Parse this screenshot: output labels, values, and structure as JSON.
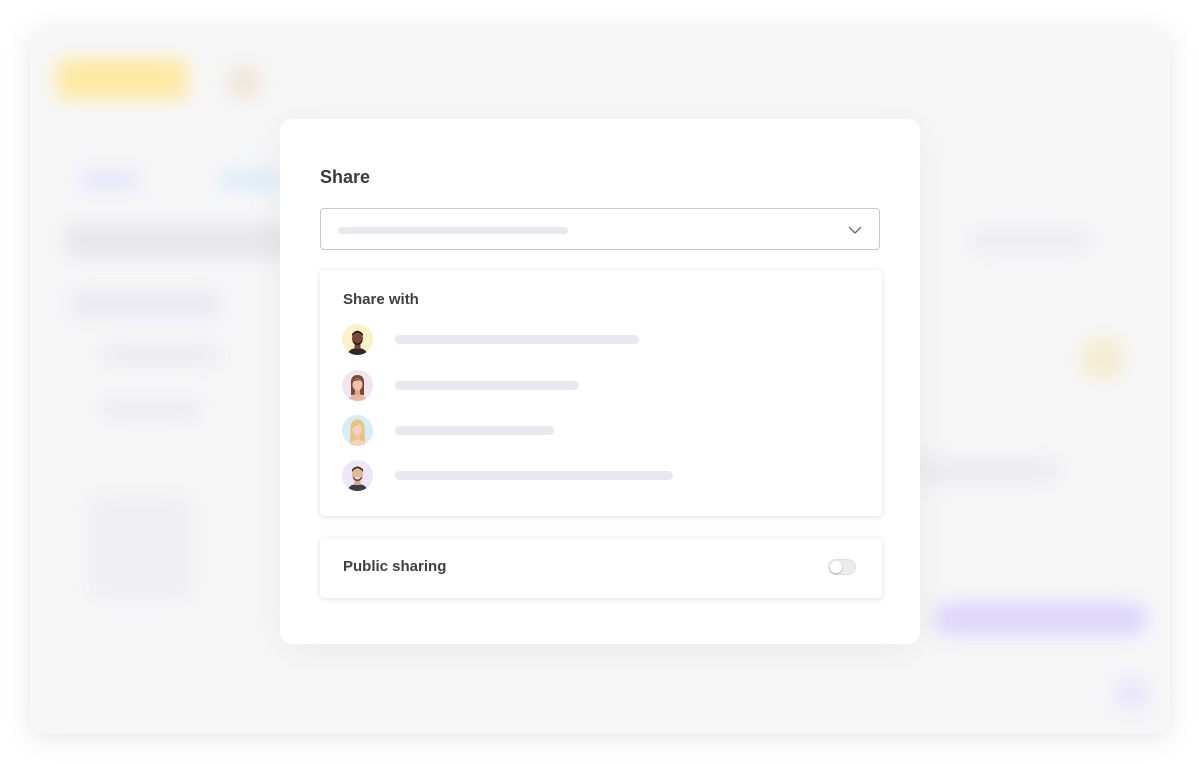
{
  "modal": {
    "title": "Share",
    "select": {
      "placeholder": "",
      "icon": "chevron-down-icon"
    },
    "share_with": {
      "heading": "Share with",
      "people": [
        {
          "name": "",
          "avatar": "avatar-man-dark-hair",
          "avatar_bg": "#fbf2c7"
        },
        {
          "name": "",
          "avatar": "avatar-woman-brown-hair",
          "avatar_bg": "#f3e4f2"
        },
        {
          "name": "",
          "avatar": "avatar-woman-blonde-hair",
          "avatar_bg": "#d7eef9"
        },
        {
          "name": "",
          "avatar": "avatar-man-beard",
          "avatar_bg": "#ede6f8"
        }
      ]
    },
    "public_sharing": {
      "label": "Public sharing",
      "enabled": false
    }
  },
  "colors": {
    "title_text": "#3a3a3f",
    "placeholder_bar": "#e8e8ee",
    "background_accent_yellow": "#fde9a3",
    "background_accent_purple": "#ddd6fb"
  }
}
